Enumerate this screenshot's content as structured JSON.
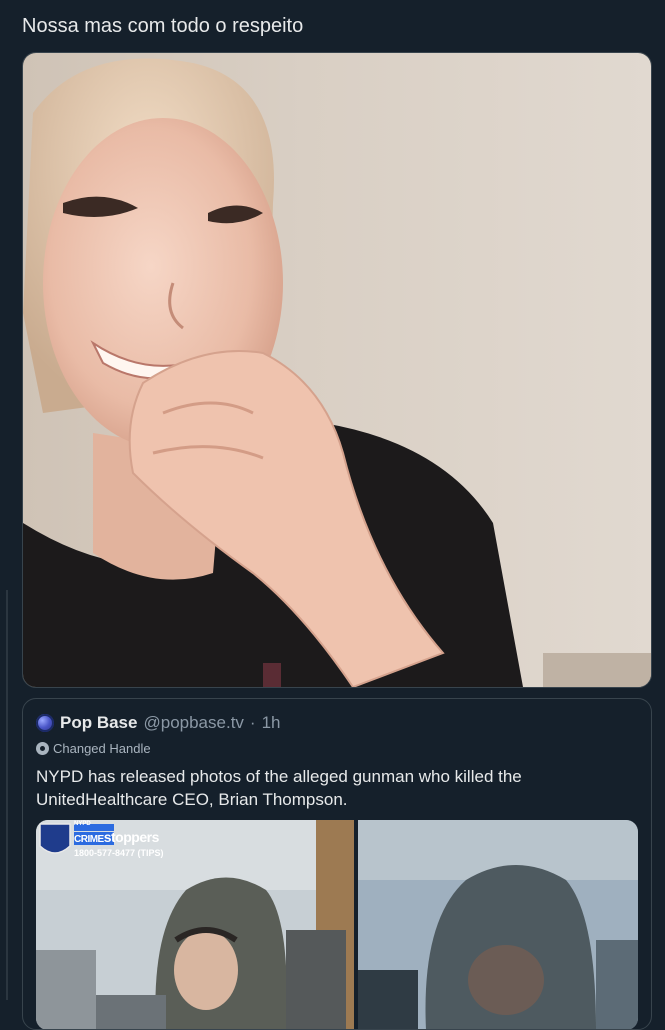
{
  "tweet": {
    "text": "Nossa mas com todo o respeito"
  },
  "quote": {
    "author_name": "Pop Base",
    "author_handle": "@popbase.tv",
    "separator": "·",
    "time": "1h",
    "badge_label": "Changed Handle",
    "text": "NYPD has released photos of the alleged gunman who killed the UnitedHealthcare CEO, Brian Thompson.",
    "crime_stoppers": {
      "top_small": "NYPD",
      "brand_crime": "CRIME",
      "brand_stoppers": "stoppers",
      "phone": "1800-577-8477 (TIPS)"
    }
  },
  "colors": {
    "background": "#15202b",
    "border": "#38444d",
    "text_primary": "#e7e9ea",
    "text_secondary": "#8b98a5"
  },
  "icons": {
    "avatar": "popbase-avatar",
    "badge": "changed-handle-icon",
    "police_shield": "nypd-shield-icon"
  }
}
